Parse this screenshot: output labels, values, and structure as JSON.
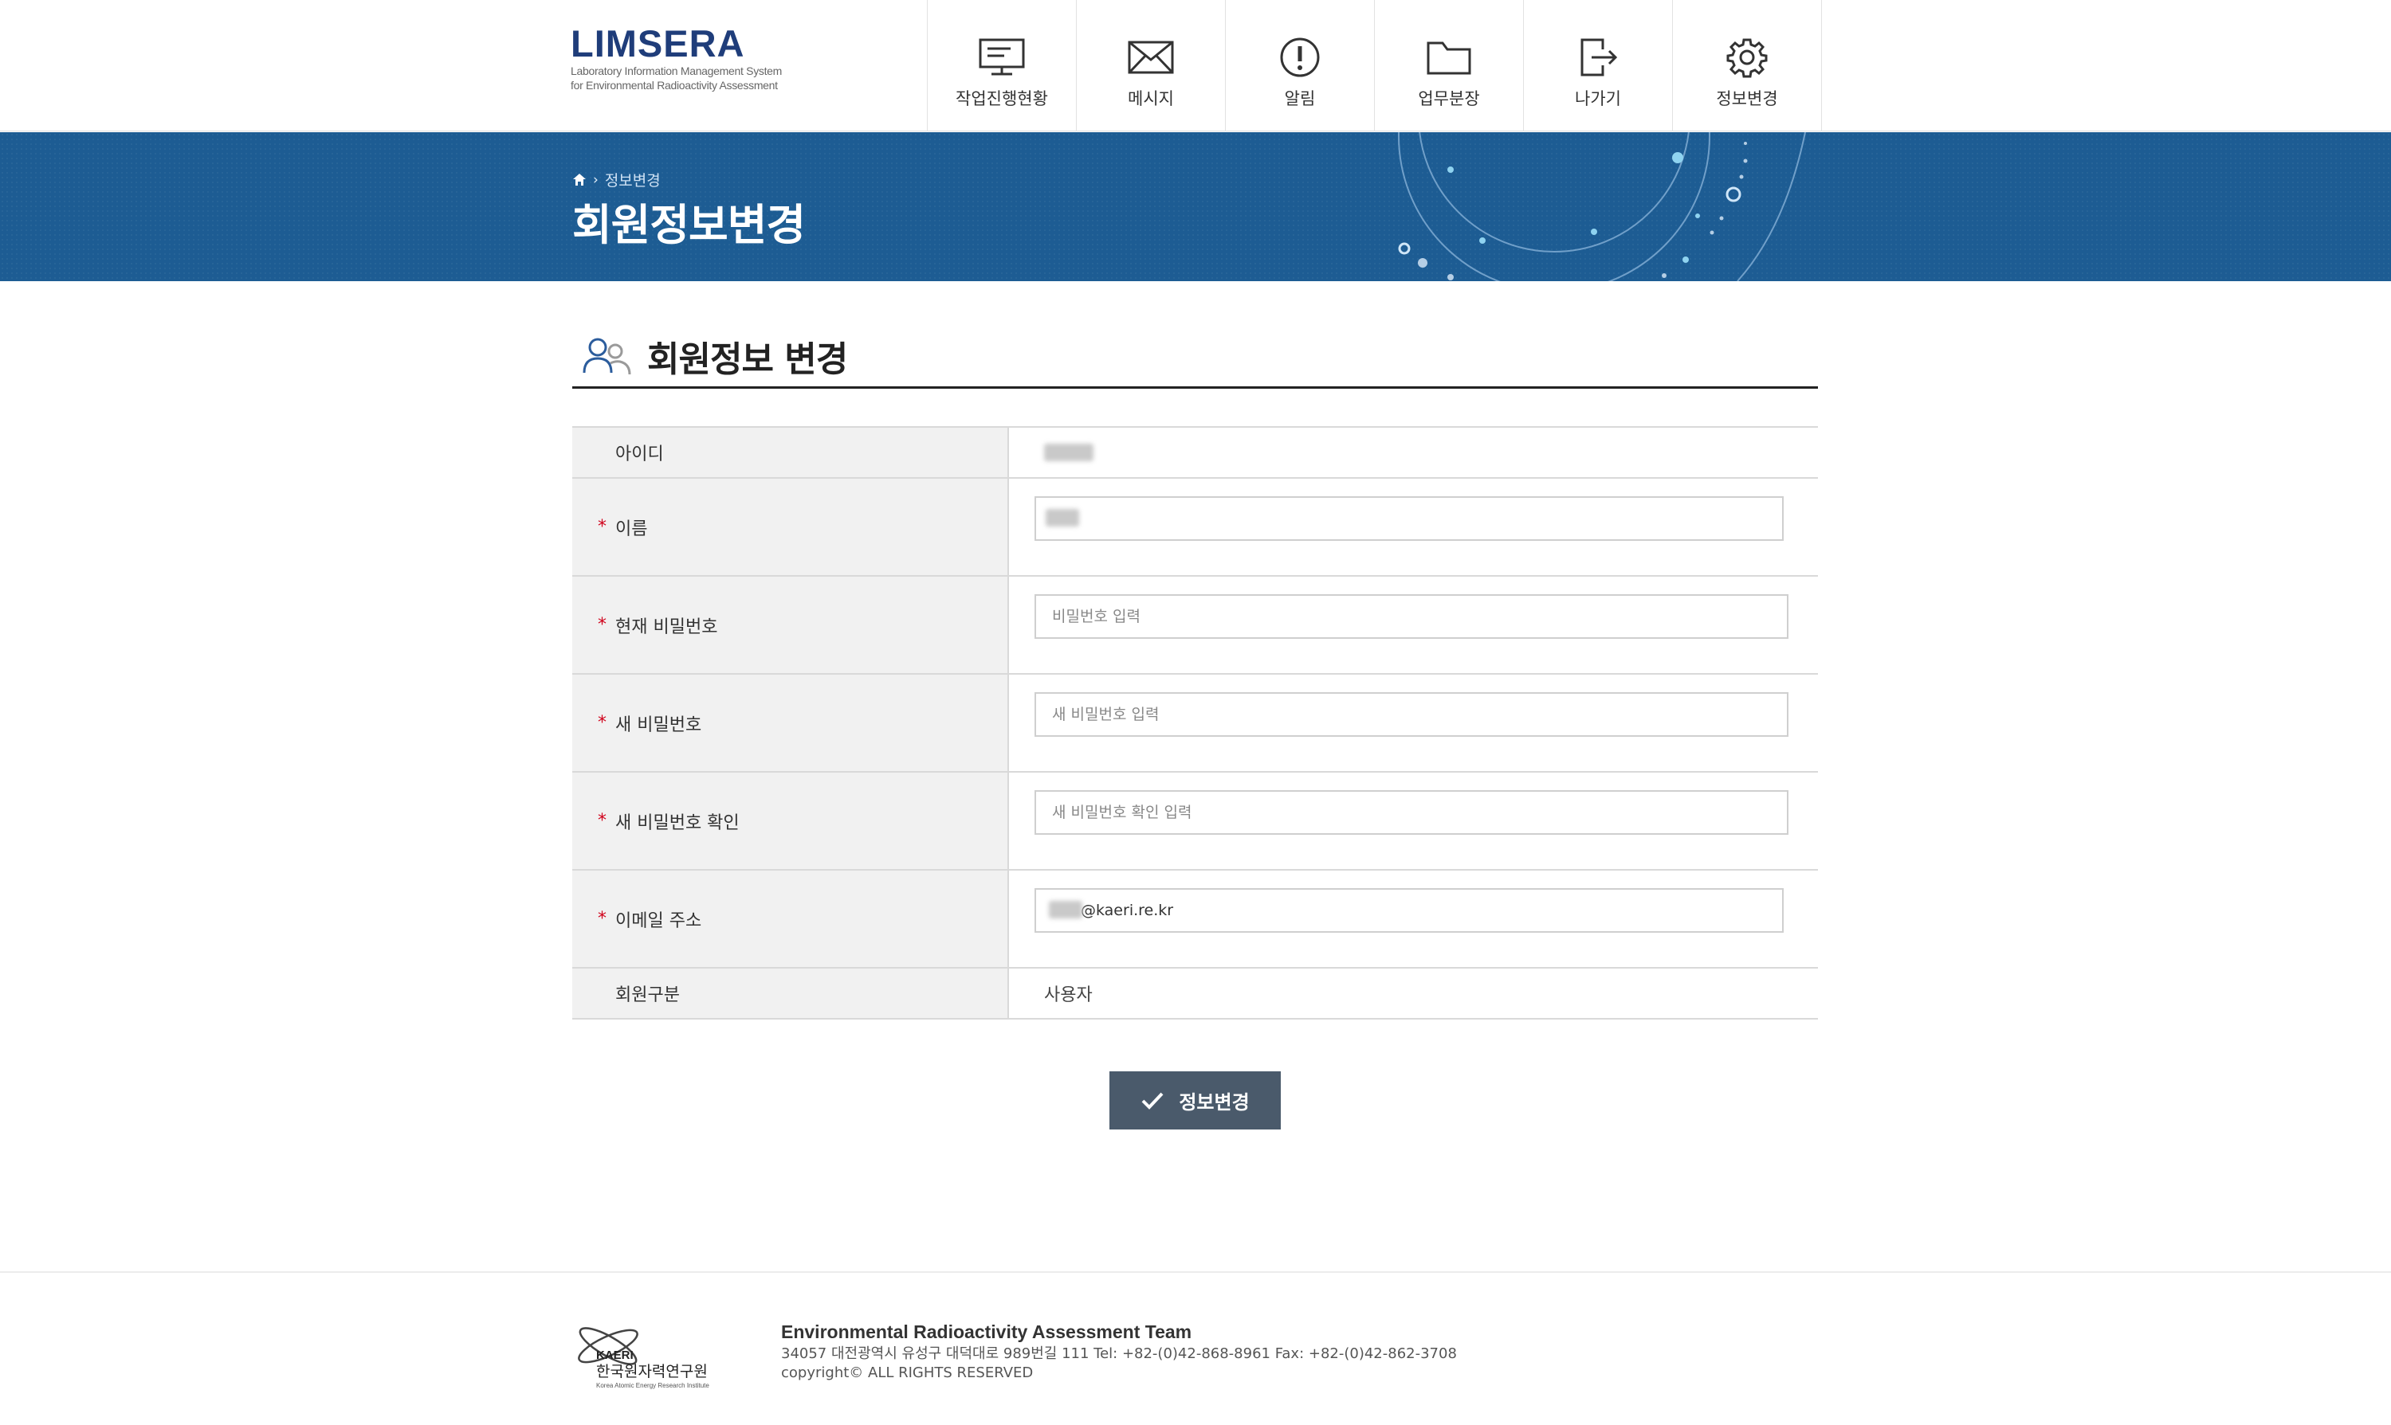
{
  "header": {
    "logo_title": "LIMSERA",
    "logo_sub_line1": "Laboratory Information Management System",
    "logo_sub_line2": "for Environmental Radioactivity Assessment",
    "nav": [
      {
        "label": "작업진행현황",
        "icon": "monitor-icon"
      },
      {
        "label": "메시지",
        "icon": "envelope-icon"
      },
      {
        "label": "알림",
        "icon": "alert-icon"
      },
      {
        "label": "업무분장",
        "icon": "folder-icon"
      },
      {
        "label": "나가기",
        "icon": "logout-icon"
      },
      {
        "label": "정보변경",
        "icon": "gear-icon"
      }
    ]
  },
  "banner": {
    "breadcrumb_current": "정보변경",
    "title": "회원정보변경"
  },
  "section": {
    "title": "회원정보 변경"
  },
  "form": {
    "id_label": "아이디",
    "name_label": "이름",
    "current_pw_label": "현재 비밀번호",
    "current_pw_placeholder": "비밀번호 입력",
    "new_pw_label": "새 비밀번호",
    "new_pw_placeholder": "새 비밀번호 입력",
    "confirm_pw_label": "새 비밀번호 확인",
    "confirm_pw_placeholder": "새 비밀번호 확인 입력",
    "email_label": "이메일 주소",
    "email_value": "@kaeri.re.kr",
    "member_type_label": "회원구분",
    "member_type_value": "사용자",
    "required_mark": "*"
  },
  "submit": {
    "label": "정보변경"
  },
  "footer": {
    "team": "Environmental Radioactivity Assessment Team",
    "address": "34057 대전광역시 유성구 대덕대로 989번길 111 Tel: +82-(0)42-868-8961 Fax: +82-(0)42-862-3708",
    "copyright": "copyright© ALL RIGHTS RESERVED",
    "logo_text": "KAERI",
    "logo_kr": "한국원자력연구원",
    "logo_en": "Korea Atomic Energy Research Institute"
  },
  "colors": {
    "brand": "#1f3d7a",
    "banner": "#1d5c93",
    "button": "#4a5a6b",
    "required": "#d0021b"
  }
}
